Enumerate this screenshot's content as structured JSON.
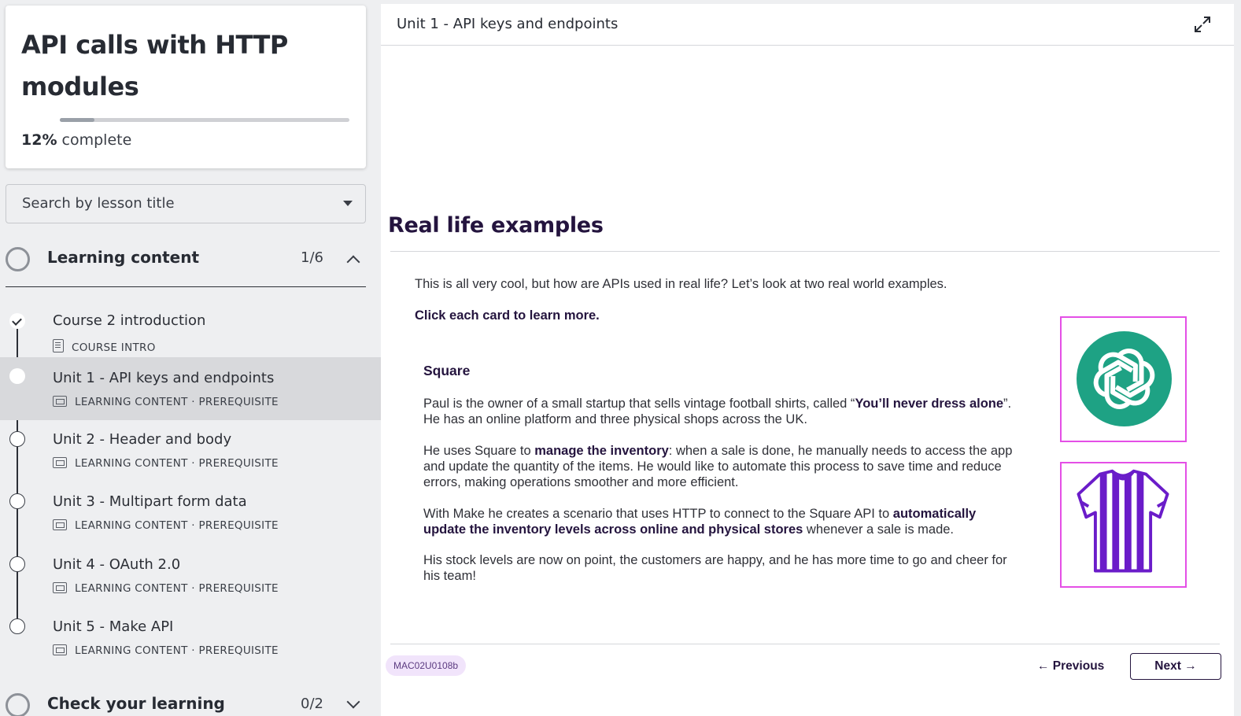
{
  "sidebar": {
    "course_title": "API calls with HTTP modules",
    "progress_percent": "12%",
    "progress_label": "complete",
    "progress_fraction": 0.12,
    "search_placeholder": "Search by lesson title",
    "sections": [
      {
        "title": "Learning content",
        "count": "1/6",
        "expanded": true
      },
      {
        "title": "Check your learning",
        "count": "0/2",
        "expanded": false
      }
    ],
    "lessons": [
      {
        "title": "Course 2 introduction",
        "meta": "COURSE INTRO",
        "status": "done"
      },
      {
        "title": "Unit 1 - API keys and endpoints",
        "meta": "LEARNING CONTENT · PREREQUISITE",
        "status": "current"
      },
      {
        "title": "Unit 2 - Header and body",
        "meta": "LEARNING CONTENT · PREREQUISITE",
        "status": "todo"
      },
      {
        "title": "Unit 3 - Multipart form data",
        "meta": "LEARNING CONTENT · PREREQUISITE",
        "status": "todo"
      },
      {
        "title": "Unit 4 - OAuth 2.0",
        "meta": "LEARNING CONTENT · PREREQUISITE",
        "status": "todo"
      },
      {
        "title": "Unit 5 - Make API",
        "meta": "LEARNING CONTENT · PREREQUISITE",
        "status": "todo"
      }
    ]
  },
  "main": {
    "header_title": "Unit 1 - API keys and endpoints",
    "heading": "Real life examples",
    "intro": "This is all very cool, but how are APIs used in real life? Let’s look at two real world examples.",
    "cta": "Click each card to learn more.",
    "card_title": "Square",
    "p1_a": "Paul is the owner of a small startup that sells vintage football shirts, called “",
    "p1_b": "You’ll never dress alone",
    "p1_c": "”. He has an online platform and three physical shops across the UK.",
    "p2_a": "He uses Square to ",
    "p2_b": "manage the inventory",
    "p2_c": ": when a sale is done, he manually needs to access the app and update the quantity of the items. He would like to automate this process to save time and reduce errors, making operations smoother and more efficient.",
    "p3_a": "With Make he creates a scenario that uses HTTP to connect to the Square API to ",
    "p3_b": "automatically update the inventory levels across online and physical stores",
    "p3_c": " whenever a sale is made.",
    "p4": "His stock levels are now on point, the customers are happy, and he has more time to go and cheer for his team!",
    "code": "MAC02U0108b",
    "prev_label": "← Previous",
    "next_label": "Next →"
  },
  "colors": {
    "accent_dark": "#24143e",
    "card_border": "#e44fe6",
    "logo_green": "#1ea284",
    "shirt_purple": "#6a1cc9",
    "badge_bg": "#f1e4fb"
  },
  "icons": [
    "expand-icon",
    "check-icon",
    "course-intro-icon",
    "learning-content-icon",
    "openai-logo-icon",
    "football-shirt-icon",
    "chevron-up-icon",
    "chevron-down-icon",
    "caret-down-icon"
  ]
}
